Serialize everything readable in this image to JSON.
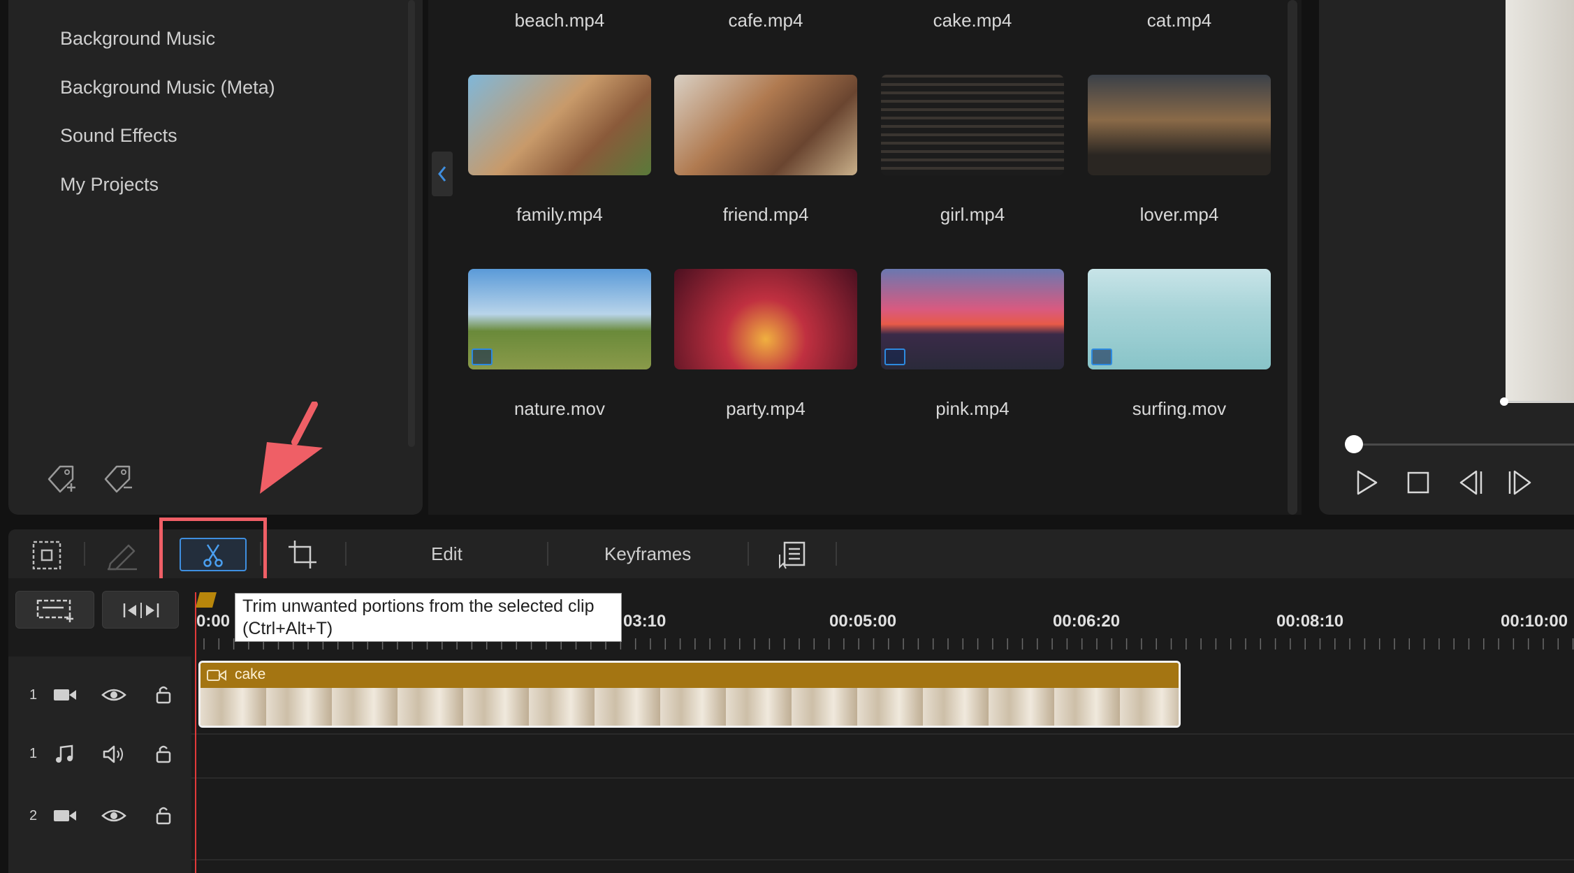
{
  "library": {
    "items": [
      {
        "label": "Background Music"
      },
      {
        "label": "Background Music (Meta)"
      },
      {
        "label": "Sound Effects"
      },
      {
        "label": "My Projects"
      }
    ]
  },
  "media": {
    "top_row_names": [
      "beach.mp4",
      "cafe.mp4",
      "cake.mp4",
      "cat.mp4"
    ],
    "items": [
      {
        "name": "family.mp4"
      },
      {
        "name": "friend.mp4"
      },
      {
        "name": "girl.mp4"
      },
      {
        "name": "lover.mp4"
      },
      {
        "name": "nature.mov"
      },
      {
        "name": "party.mp4"
      },
      {
        "name": "pink.mp4"
      },
      {
        "name": "surfing.mov"
      }
    ]
  },
  "toolbar": {
    "edit_label": "Edit",
    "keyframes_label": "Keyframes"
  },
  "tooltip": {
    "line1": "Trim unwanted portions from the selected clip",
    "line2": "(Ctrl+Alt+T)"
  },
  "timeline": {
    "ticks": [
      "0:00",
      ":03:10",
      "00:05:00",
      "00:06:20",
      "00:08:10",
      "00:10:00"
    ],
    "clip_label": "cake",
    "tracks": [
      {
        "number": "1",
        "type": "video"
      },
      {
        "number": "1",
        "type": "audio"
      },
      {
        "number": "2",
        "type": "video"
      }
    ]
  },
  "colors": {
    "accent": "#3f8fe0",
    "highlight": "#ef5f66",
    "clip": "#a47512",
    "playhead": "#e23a3a"
  }
}
